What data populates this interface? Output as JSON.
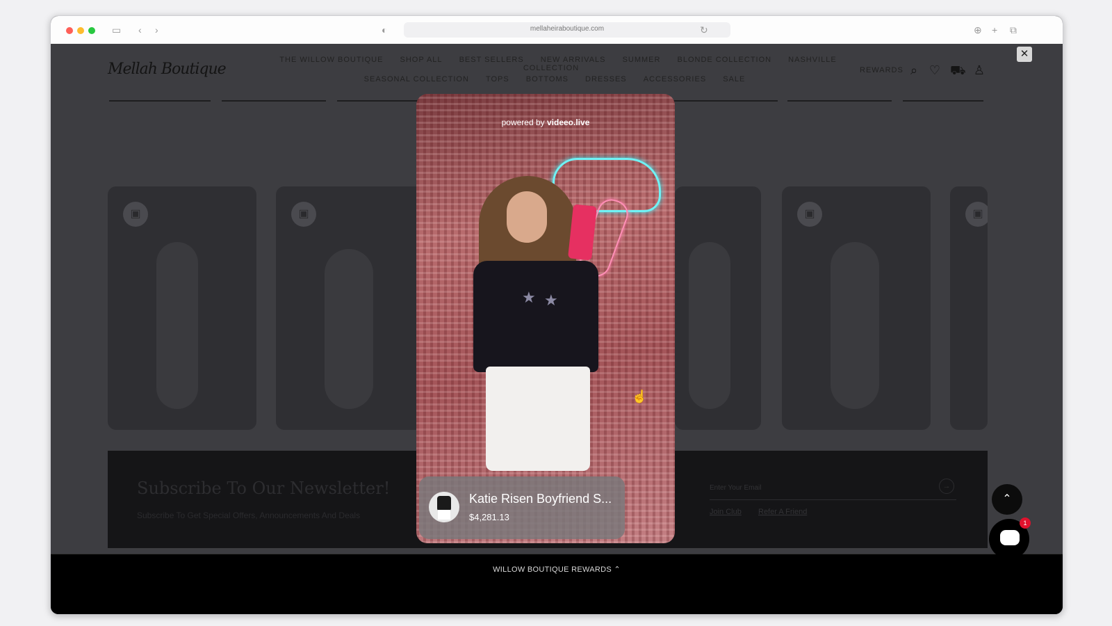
{
  "browser": {
    "url": "mellaheiraboutique.com"
  },
  "site": {
    "logo_text": "Mellah Boutique",
    "nav_row1": [
      "THE WILLOW BOUTIQUE",
      "SHOP ALL",
      "BEST SELLERS",
      "NEW ARRIVALS",
      "SUMMER",
      "BLONDE COLLECTION",
      "NASHVILLE COLLECTION"
    ],
    "nav_row2": [
      "SEASONAL COLLECTION",
      "TOPS",
      "BOTTOMS",
      "DRESSES",
      "ACCESSORIES",
      "SALE"
    ],
    "rewards_label": "REWARDS"
  },
  "newsletter": {
    "title": "Subscribe To Our Newsletter!",
    "subtitle": "Subscribe To Get Special Offers, Announcements And Deals",
    "email_placeholder": "Enter Your Email",
    "link_join": "Join Club",
    "link_refer": "Refer A Friend"
  },
  "rewards_tab": "WILLOW BOUTIQUE REWARDS",
  "video": {
    "powered_prefix": "powered by",
    "powered_brand": "videeo.live",
    "product_name": "Katie Risen Boyfriend S...",
    "product_price": "$4,281.13"
  },
  "chat": {
    "badge_count": "1"
  }
}
